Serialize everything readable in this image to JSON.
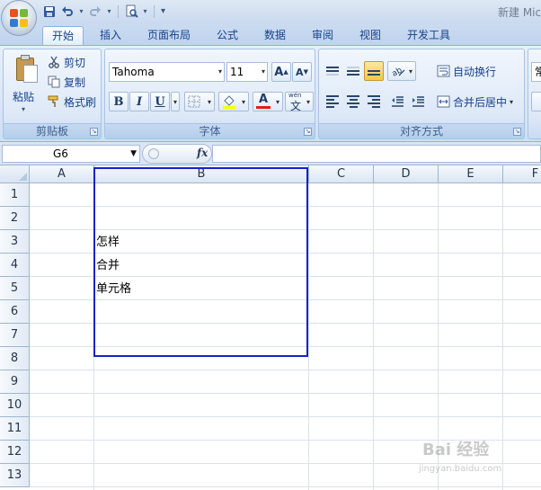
{
  "app": {
    "document_title": "新建 Mic",
    "office_button_icon": "office-logo-icon",
    "quick_access": [
      {
        "name": "save-icon",
        "glyph": "💾"
      },
      {
        "name": "undo-icon",
        "glyph": "↶"
      },
      {
        "name": "redo-icon",
        "glyph": "↷"
      },
      {
        "name": "print-preview-icon",
        "glyph": "🔍"
      }
    ]
  },
  "tabs": [
    {
      "label": "开始",
      "active": true
    },
    {
      "label": "插入",
      "active": false
    },
    {
      "label": "页面布局",
      "active": false
    },
    {
      "label": "公式",
      "active": false
    },
    {
      "label": "数据",
      "active": false
    },
    {
      "label": "审阅",
      "active": false
    },
    {
      "label": "视图",
      "active": false
    },
    {
      "label": "开发工具",
      "active": false
    }
  ],
  "ribbon": {
    "clipboard": {
      "label": "剪贴板",
      "paste": "粘贴",
      "cut": "剪切",
      "copy": "复制",
      "format_painter": "格式刷"
    },
    "font": {
      "label": "字体",
      "font_name": "Tahoma",
      "font_size": "11",
      "grow": "A",
      "shrink": "A",
      "bold": "B",
      "italic": "I",
      "underline": "U",
      "font_color_letter": "A",
      "phonetic": "wén",
      "phonetic_char": "文"
    },
    "alignment": {
      "label": "对齐方式",
      "wrap_text": "自动换行",
      "merge_center": "合并后居中",
      "partial_next_group": "常"
    }
  },
  "formula_bar": {
    "name_box": "G6",
    "fx": "fx",
    "formula": ""
  },
  "grid": {
    "columns": [
      "A",
      "B",
      "C",
      "D",
      "E",
      "F"
    ],
    "rows": [
      "1",
      "2",
      "3",
      "4",
      "5",
      "6",
      "7",
      "8",
      "9",
      "10",
      "11",
      "12",
      "13"
    ],
    "cells": {
      "B3": "怎样",
      "B4": "合并",
      "B5": "单元格"
    }
  },
  "watermark": {
    "brand": "Bai 经验",
    "url": "jingyan.baidu.com"
  },
  "colors": {
    "accent": "#15428b",
    "highlight_border": "#1422c8",
    "active_alignment": "#f8c64b"
  }
}
